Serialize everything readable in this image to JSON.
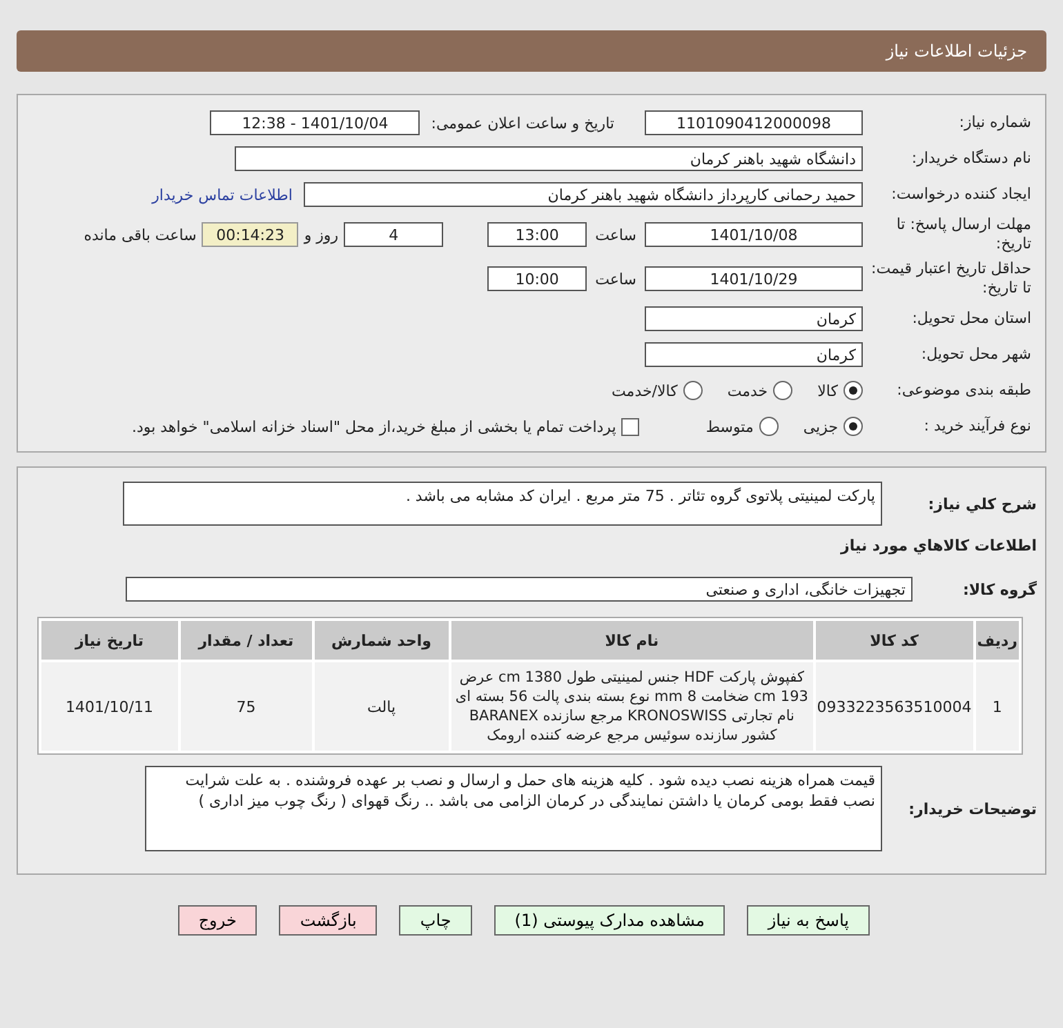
{
  "header": {
    "title": "جزئیات اطلاعات نیاز"
  },
  "need_number": {
    "label": "شماره نیاز:",
    "value": "1101090412000098"
  },
  "announce": {
    "label": "تاریخ و ساعت اعلان عمومی:",
    "value": "1401/10/04 - 12:38"
  },
  "buyer_org": {
    "label": "نام دستگاه خریدار:",
    "value": "دانشگاه شهید باهنر کرمان"
  },
  "requester": {
    "label": "ایجاد کننده درخواست:",
    "value": "حمید  رحمانی کارپرداز دانشگاه شهید باهنر کرمان",
    "link": "اطلاعات تماس خریدار"
  },
  "deadline": {
    "label": "مهلت ارسال پاسخ: تا تاریخ:",
    "date": "1401/10/08",
    "time_label": "ساعت",
    "time": "13:00",
    "days": "4",
    "days_label": "روز و",
    "remaining": "00:14:23",
    "remaining_label": "ساعت باقی مانده"
  },
  "validity": {
    "label": "حداقل تاریخ اعتبار قیمت: تا تاریخ:",
    "date": "1401/10/29",
    "time_label": "ساعت",
    "time": "10:00"
  },
  "province": {
    "label": "استان محل تحویل:",
    "value": "کرمان"
  },
  "city": {
    "label": "شهر محل تحویل:",
    "value": "کرمان"
  },
  "category": {
    "label": "طبقه بندی موضوعی:",
    "options": [
      {
        "label": "کالا",
        "selected": true
      },
      {
        "label": "خدمت",
        "selected": false
      },
      {
        "label": "کالا/خدمت",
        "selected": false
      }
    ]
  },
  "process": {
    "label": "نوع فرآیند خرید :",
    "options": [
      {
        "label": "جزیی",
        "selected": true
      },
      {
        "label": "متوسط",
        "selected": false
      }
    ],
    "checkbox": {
      "label": "پرداخت تمام یا بخشی از مبلغ خرید،از محل \"اسناد خزانه اسلامی\" خواهد بود.",
      "checked": false
    }
  },
  "description": {
    "label": "شرح کلي نياز:",
    "value": "پارکت لمینیتی پلاتوی گروه تئاتر . 75 متر مربع . ایران کد مشابه می باشد ."
  },
  "goods_title": "اطلاعات کالاهاي مورد نياز",
  "group": {
    "label": "گروه کالا:",
    "value": "تجهیزات خانگی، اداری و صنعتی"
  },
  "table": {
    "columns": [
      "ردیف",
      "کد کالا",
      "نام کالا",
      "واحد شمارش",
      "تعداد / مقدار",
      "تاریخ نیاز"
    ],
    "rows": [
      [
        "1",
        "0933223563510004",
        "کفپوش پارکت HDF جنس لمینیتی طول 1380 cm عرض 193 cm ضخامت 8 mm نوع بسته بندی پالت 56 بسته ای نام تجارتی KRONOSWISS مرجع سازنده BARANEX کشور سازنده سوئیس مرجع عرضه کننده ارومک",
        "پالت",
        "75",
        "1401/10/11"
      ]
    ]
  },
  "buyer_notes": {
    "label": "توضیحات خریدار:",
    "value": "قیمت همراه هزینه نصب دیده شود . کلیه هزینه های حمل و ارسال و نصب بر عهده فروشنده . به علت شرایت نصب فقط بومی کرمان یا داشتن نمایندگی در کرمان الزامی می باشد .. رنگ قهوای ( رنگ چوب میز اداری )"
  },
  "buttons": [
    {
      "label": "پاسخ به نیاز",
      "kind": "green"
    },
    {
      "label": "مشاهده مدارک پیوستی (1)",
      "kind": "green"
    },
    {
      "label": "چاپ",
      "kind": "green"
    },
    {
      "label": "بازگشت",
      "kind": "red"
    },
    {
      "label": "خروج",
      "kind": "red"
    }
  ]
}
